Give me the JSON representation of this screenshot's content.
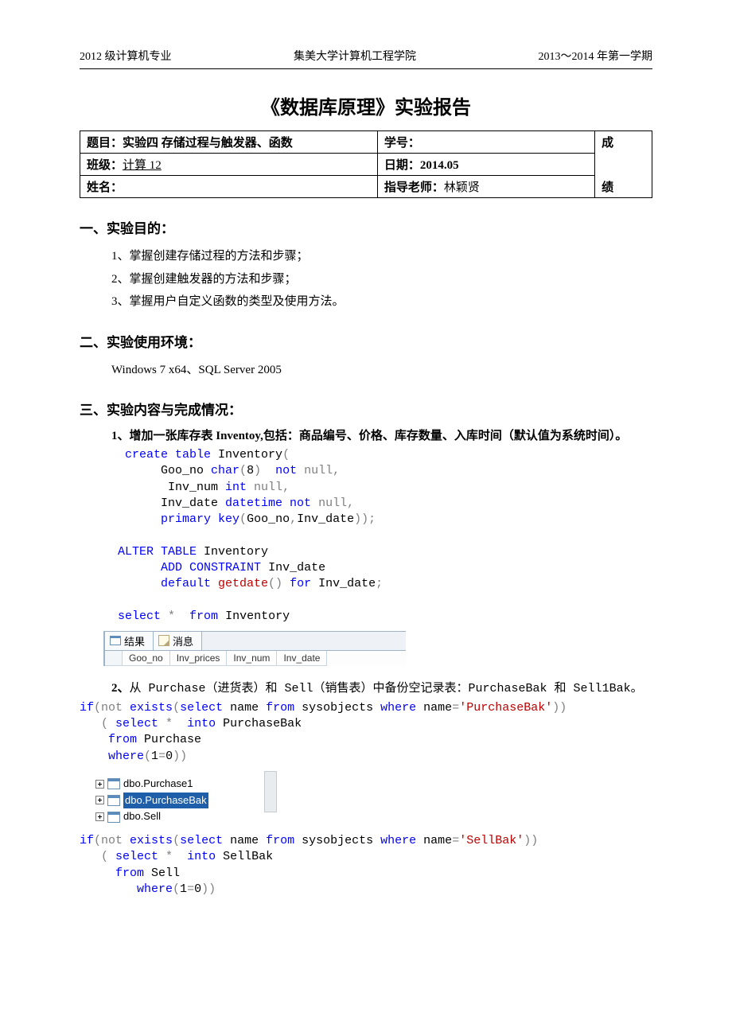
{
  "header": {
    "left": "2012 级计算机专业",
    "center": "集美大学计算机工程学院",
    "right": "2013～2014 年第一学期"
  },
  "title": "《数据库原理》实验报告",
  "info": {
    "topic_label": "题目：",
    "topic_value": "实验四 存储过程与触发器、函数",
    "studentid_label": "学号：",
    "class_label": "班级：",
    "class_value": "计算 12",
    "date_label": "日期：",
    "date_value": "2014.05",
    "name_label": "姓名：",
    "teacher_label": "指导老师：",
    "teacher_value": "林颖贤",
    "grade_top": "成",
    "grade_bot": "绩"
  },
  "sections": {
    "s1_title": "一、实验目的：",
    "s1_items": [
      "1、掌握创建存储过程的方法和步骤；",
      "2、掌握创建触发器的方法和步骤；",
      "3、掌握用户自定义函数的类型及使用方法。"
    ],
    "s2_title": "二、实验使用环境：",
    "s2_body": "Windows 7 x64、SQL Server 2005",
    "s3_title": "三、实验内容与完成情况：",
    "q1": "1、增加一张库存表 Inventoy,包括：商品编号、价格、库存数量、入库时间（默认值为系统时间）。",
    "q2_pre": "2、",
    "q2_a": "从 Purchase（进货表）和 Sell（销售表）中备份空记录表：PurchaseBak 和 Sell1Bak。"
  },
  "code1": {
    "l1a": "create",
    "l1b": " table",
    "l1c": " Inventory",
    "l2a": "Goo_no ",
    "l2b": "char",
    "l2c": "8",
    "l2d": "not",
    "l2e": " null",
    "l3a": "Inv_num ",
    "l3b": "int",
    "l3c": " null",
    "l4a": "Inv_date ",
    "l4b": "datetime",
    "l4c": " not",
    "l4d": " null",
    "l5a": "primary",
    "l5b": " key",
    "l5c": "Goo_no",
    "l5d": "Inv_date",
    "l6a": "ALTER",
    "l6b": " TABLE",
    "l6c": " Inventory",
    "l7a": "ADD",
    "l7b": " CONSTRAINT",
    "l7c": " Inv_date",
    "l8a": "default",
    "l8b": " getdate",
    "l8c": " for",
    "l8d": " Inv_date",
    "l9a": "select",
    "l9b": " from",
    "l9c": " Inventory"
  },
  "results1": {
    "tab1": "结果",
    "tab2": "消息",
    "cols": [
      "Goo_no",
      "Inv_prices",
      "Inv_num",
      "Inv_date"
    ]
  },
  "code2": {
    "l1a": "if",
    "l1b": "not",
    "l1c": " exists",
    "l1d": "select",
    "l1e": " name ",
    "l1f": "from",
    "l1g": " sysobjects ",
    "l1h": "where",
    "l1i": " name",
    "l1j": "'PurchaseBak'",
    "l2a": "select",
    "l2b": " into",
    "l2c": " PurchaseBak",
    "l3a": "from",
    "l3b": " Purchase",
    "l4a": "where",
    "l4b": "1",
    "l4c": "0"
  },
  "tree": {
    "n1": "dbo.Purchase1",
    "n2": "dbo.PurchaseBak",
    "n3": "dbo.Sell"
  },
  "code3": {
    "l1a": "if",
    "l1b": "not",
    "l1c": " exists",
    "l1d": "select",
    "l1e": " name ",
    "l1f": "from",
    "l1g": " sysobjects ",
    "l1h": "where",
    "l1i": " name",
    "l1j": "'SellBak'",
    "l2a": "select",
    "l2b": " into",
    "l2c": " SellBak",
    "l3a": "from",
    "l3b": " Sell",
    "l4a": "where",
    "l4b": "1",
    "l4c": "0"
  }
}
